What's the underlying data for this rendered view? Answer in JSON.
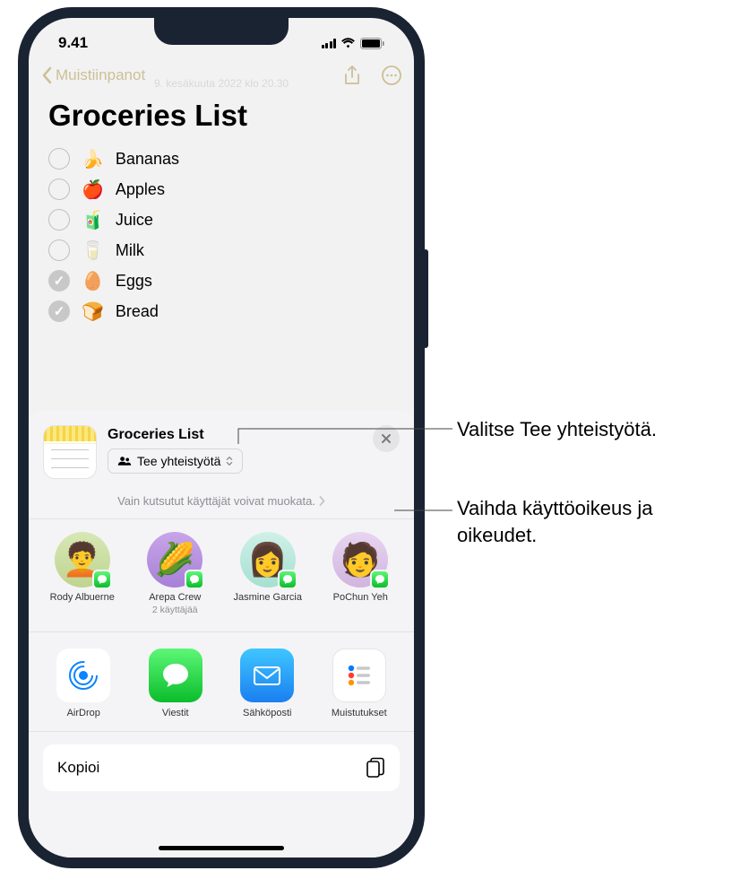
{
  "statusBar": {
    "time": "9.41"
  },
  "nav": {
    "back_label": "Muistiinpanot"
  },
  "note": {
    "date_meta": "9. kesäkuuta 2022 klo 20.30",
    "title": "Groceries List",
    "items": [
      {
        "emoji": "🍌",
        "text": "Bananas",
        "checked": false
      },
      {
        "emoji": "🍎",
        "text": "Apples",
        "checked": false
      },
      {
        "emoji": "🧃",
        "text": "Juice",
        "checked": false
      },
      {
        "emoji": "🥛",
        "text": "Milk",
        "checked": false
      },
      {
        "emoji": "🥚",
        "text": "Eggs",
        "checked": true
      },
      {
        "emoji": "🍞",
        "text": "Bread",
        "checked": true
      }
    ]
  },
  "sheet": {
    "title": "Groceries List",
    "collab_label": "Tee yhteistyötä",
    "permissions_text": "Vain kutsutut käyttäjät voivat muokata.",
    "contacts": [
      {
        "name": "Rody Albuerne",
        "sub": ""
      },
      {
        "name": "Arepa Crew",
        "sub": "2 käyttäjää"
      },
      {
        "name": "Jasmine Garcia",
        "sub": ""
      },
      {
        "name": "PoChun Yeh",
        "sub": ""
      }
    ],
    "apps": [
      {
        "label": "AirDrop"
      },
      {
        "label": "Viestit"
      },
      {
        "label": "Sähköposti"
      },
      {
        "label": "Muistutukset"
      }
    ],
    "copy_label": "Kopioi"
  },
  "callouts": {
    "c1": "Valitse Tee yhteistyötä.",
    "c2": "Vaihda käyttöoikeus ja oikeudet."
  }
}
